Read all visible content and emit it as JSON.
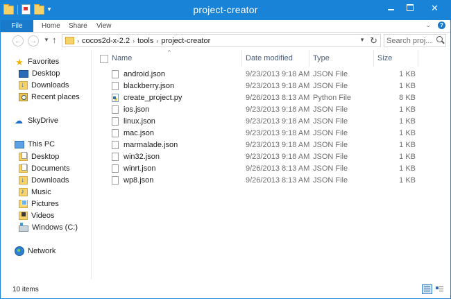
{
  "window": {
    "title": "project-creator",
    "controls": {
      "minimize": "minimize-icon",
      "maximize": "maximize-icon",
      "close": "close-icon"
    }
  },
  "colors": {
    "accent": "#1883d7",
    "file_tab": "#1979ca",
    "header_text": "#4c607a",
    "secondary_text": "#6d6d6d"
  },
  "ribbon": {
    "tabs": [
      {
        "label": "File"
      },
      {
        "label": "Home"
      },
      {
        "label": "Share"
      },
      {
        "label": "View"
      }
    ]
  },
  "address": {
    "crumbs": [
      "cocos2d-x-2.2",
      "tools",
      "project-creator"
    ],
    "search_placeholder": "Search proj..."
  },
  "nav": {
    "favorites": {
      "label": "Favorites",
      "items": [
        {
          "label": "Desktop"
        },
        {
          "label": "Downloads"
        },
        {
          "label": "Recent places"
        }
      ]
    },
    "skydrive": {
      "label": "SkyDrive"
    },
    "this_pc": {
      "label": "This PC",
      "items": [
        {
          "label": "Desktop"
        },
        {
          "label": "Documents"
        },
        {
          "label": "Downloads"
        },
        {
          "label": "Music"
        },
        {
          "label": "Pictures"
        },
        {
          "label": "Videos"
        },
        {
          "label": "Windows (C:)"
        }
      ]
    },
    "network": {
      "label": "Network"
    }
  },
  "columns": {
    "name": "Name",
    "date": "Date modified",
    "type": "Type",
    "size": "Size"
  },
  "files": [
    {
      "name": "android.json",
      "date": "9/23/2013 9:18 AM",
      "type": "JSON File",
      "size": "1 KB"
    },
    {
      "name": "blackberry.json",
      "date": "9/23/2013 9:18 AM",
      "type": "JSON File",
      "size": "1 KB"
    },
    {
      "name": "create_project.py",
      "date": "9/26/2013 8:13 AM",
      "type": "Python File",
      "size": "8 KB"
    },
    {
      "name": "ios.json",
      "date": "9/23/2013 9:18 AM",
      "type": "JSON File",
      "size": "1 KB"
    },
    {
      "name": "linux.json",
      "date": "9/23/2013 9:18 AM",
      "type": "JSON File",
      "size": "1 KB"
    },
    {
      "name": "mac.json",
      "date": "9/23/2013 9:18 AM",
      "type": "JSON File",
      "size": "1 KB"
    },
    {
      "name": "marmalade.json",
      "date": "9/23/2013 9:18 AM",
      "type": "JSON File",
      "size": "1 KB"
    },
    {
      "name": "win32.json",
      "date": "9/23/2013 9:18 AM",
      "type": "JSON File",
      "size": "1 KB"
    },
    {
      "name": "winrt.json",
      "date": "9/26/2013 8:13 AM",
      "type": "JSON File",
      "size": "1 KB"
    },
    {
      "name": "wp8.json",
      "date": "9/26/2013 8:13 AM",
      "type": "JSON File",
      "size": "1 KB"
    }
  ],
  "status": {
    "count": "10 items"
  }
}
